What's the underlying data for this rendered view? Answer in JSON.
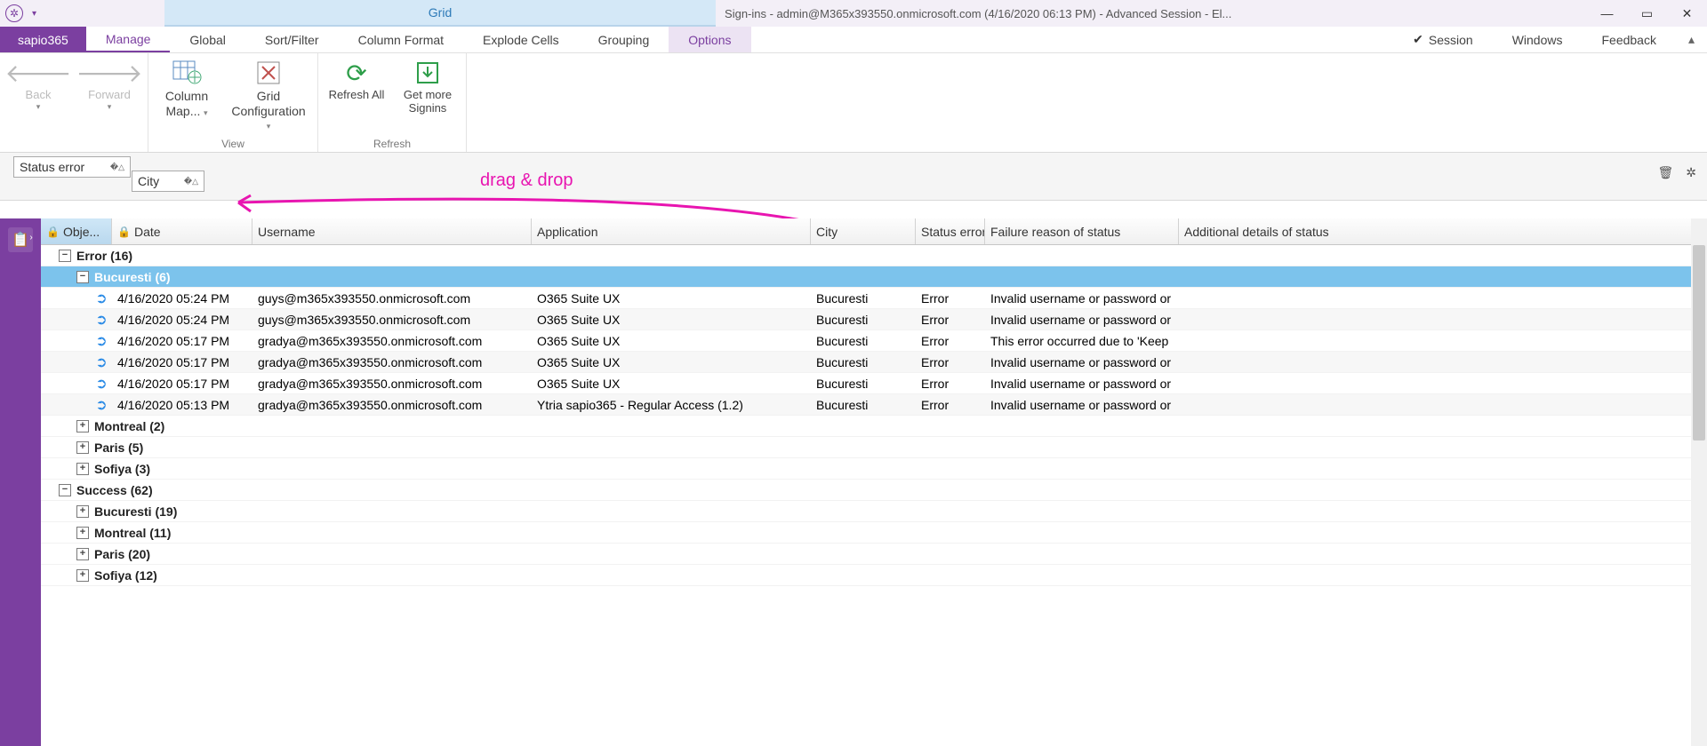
{
  "titlebar": {
    "grid_tab": "Grid",
    "title": "Sign-ins - admin@M365x393550.onmicrosoft.com (4/16/2020 06:13 PM) - Advanced Session - El..."
  },
  "ribbon_tabs": {
    "app": "sapio365",
    "manage": "Manage",
    "global": "Global",
    "sortfilter": "Sort/Filter",
    "colformat": "Column Format",
    "explode": "Explode Cells",
    "grouping": "Grouping",
    "options": "Options",
    "session": "Session",
    "windows": "Windows",
    "feedback": "Feedback"
  },
  "ribbon": {
    "back": "Back",
    "forward": "Forward",
    "colmap": "Column\nMap...",
    "gridcfg": "Grid\nConfiguration",
    "view_group": "View",
    "refresh_all": "Refresh\nAll",
    "get_more": "Get more\nSignins",
    "refresh_group": "Refresh"
  },
  "group_chips": {
    "c1": "Status error",
    "c2": "City"
  },
  "annotation": "drag & drop",
  "columns": {
    "obj": "Obje...",
    "date": "Date",
    "user": "Username",
    "app": "Application",
    "city": "City",
    "stat": "Status error",
    "fail": "Failure reason of status",
    "add": "Additional details of status"
  },
  "groups": {
    "error": "Error (16)",
    "bucuresti": "Bucuresti (6)",
    "montreal": "Montreal (2)",
    "paris": "Paris (5)",
    "sofiya": "Sofiya (3)",
    "success": "Success (62)",
    "s_bucuresti": "Bucuresti (19)",
    "s_montreal": "Montreal (11)",
    "s_paris": "Paris (20)",
    "s_sofiya": "Sofiya (12)"
  },
  "rows": [
    {
      "date": "4/16/2020 05:24 PM",
      "user": "guys@m365x393550.onmicrosoft.com",
      "app": "O365 Suite UX",
      "city": "Bucuresti",
      "stat": "Error",
      "fail": "Invalid username or password or"
    },
    {
      "date": "4/16/2020 05:24 PM",
      "user": "guys@m365x393550.onmicrosoft.com",
      "app": "O365 Suite UX",
      "city": "Bucuresti",
      "stat": "Error",
      "fail": "Invalid username or password or"
    },
    {
      "date": "4/16/2020 05:17 PM",
      "user": "gradya@m365x393550.onmicrosoft.com",
      "app": "O365 Suite UX",
      "city": "Bucuresti",
      "stat": "Error",
      "fail": "This error occurred due to 'Keep"
    },
    {
      "date": "4/16/2020 05:17 PM",
      "user": "gradya@m365x393550.onmicrosoft.com",
      "app": "O365 Suite UX",
      "city": "Bucuresti",
      "stat": "Error",
      "fail": "Invalid username or password or"
    },
    {
      "date": "4/16/2020 05:17 PM",
      "user": "gradya@m365x393550.onmicrosoft.com",
      "app": "O365 Suite UX",
      "city": "Bucuresti",
      "stat": "Error",
      "fail": "Invalid username or password or"
    },
    {
      "date": "4/16/2020 05:13 PM",
      "user": "gradya@m365x393550.onmicrosoft.com",
      "app": "Ytria sapio365 - Regular Access (1.2)",
      "city": "Bucuresti",
      "stat": "Error",
      "fail": "Invalid username or password or"
    }
  ]
}
